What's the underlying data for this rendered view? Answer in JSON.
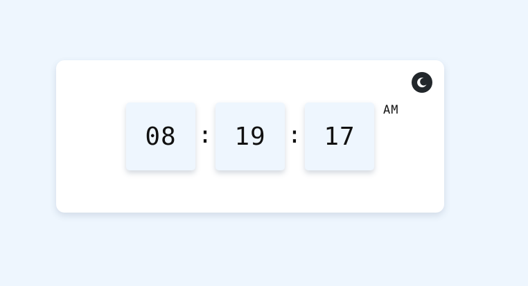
{
  "clock": {
    "hours": "08",
    "minutes": "19",
    "seconds": "17",
    "separator": ":",
    "period": "AM"
  },
  "theme_toggle": {
    "icon": "moon-icon",
    "mode": "dark"
  },
  "colors": {
    "page_background": "#eef6fe",
    "card_background": "#ffffff",
    "digit_box_background": "#eef6fe",
    "toggle_background": "#22272b",
    "text": "#111111"
  }
}
